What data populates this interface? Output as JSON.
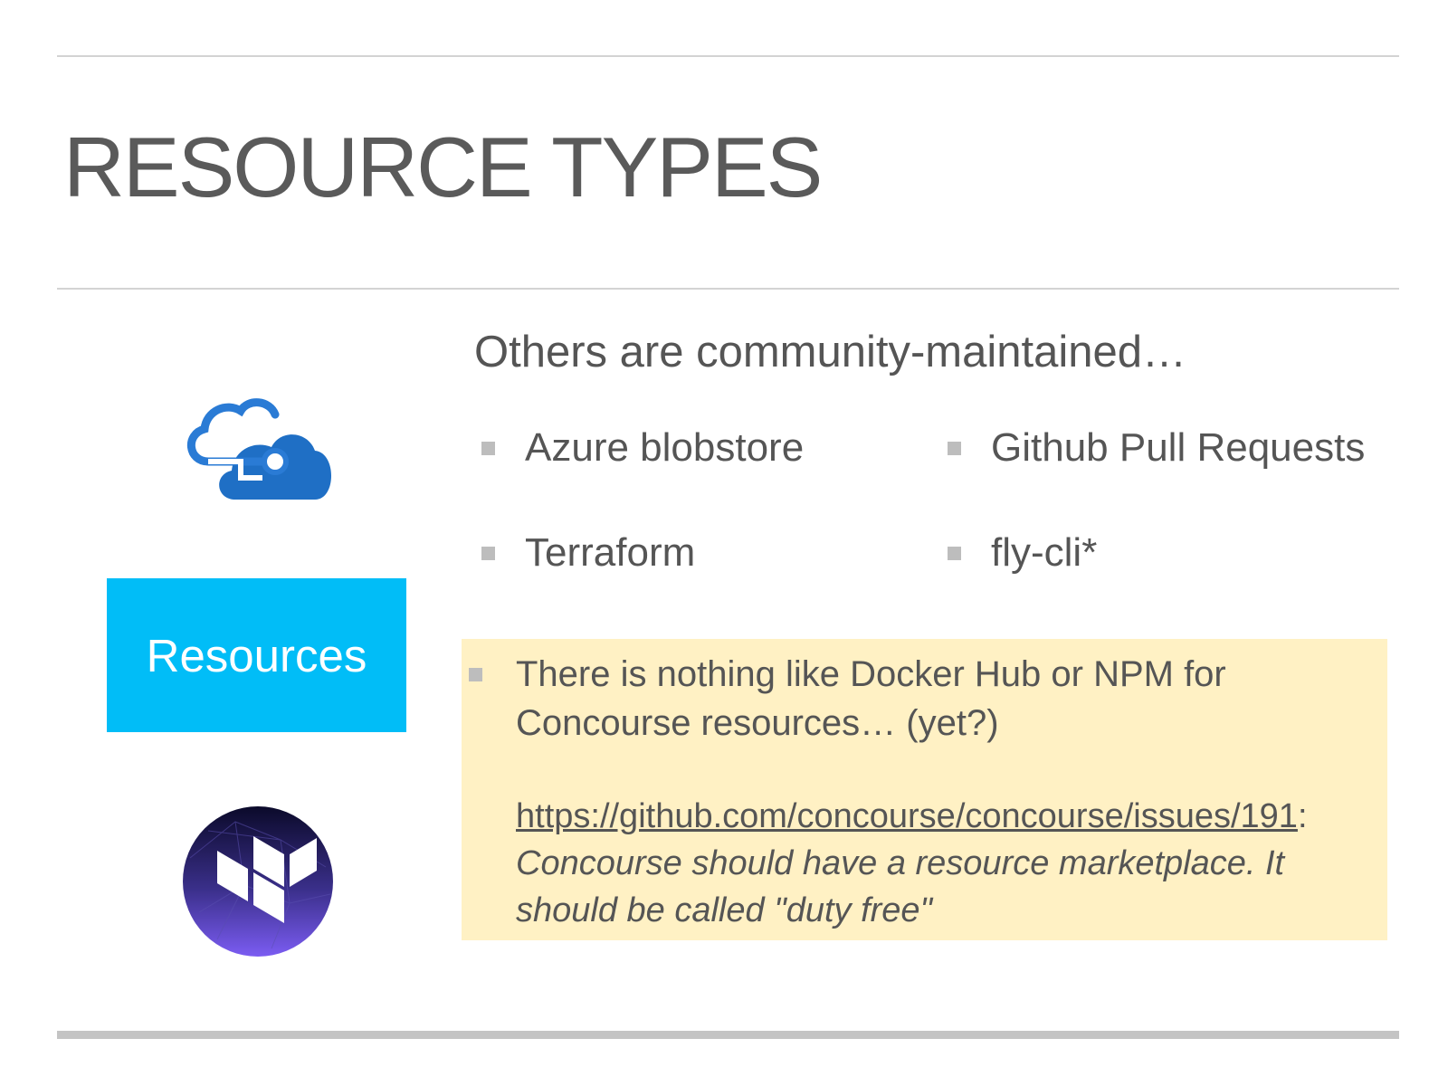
{
  "slide": {
    "title": "RESOURCE TYPES",
    "subtitle": "Others are community-maintained…",
    "bullets": [
      "Azure blobstore",
      "Github Pull Requests",
      "Terraform",
      "fly-cli*"
    ],
    "resources_label": "Resources",
    "note": {
      "line1": "There is nothing like Docker Hub or NPM for",
      "line2": "Concourse resources… (yet?)",
      "link": "https://github.com/concourse/concourse/issues/191",
      "link_suffix": ":",
      "quote_line1": "Concourse should have a resource marketplace. It",
      "quote_line2": "should be called \"duty free\""
    }
  },
  "icons": {
    "azure": "azure-cloud-icon",
    "terraform": "terraform-logo"
  },
  "colors": {
    "resources_box": "#01bdf7",
    "note_background": "#fff1c4",
    "azure_blue": "#1f6fc5",
    "text": "#555555"
  }
}
